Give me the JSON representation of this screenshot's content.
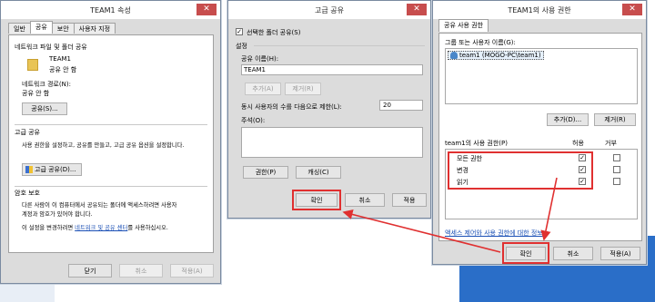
{
  "props": {
    "title": "TEAM1 속성",
    "close_glyph": "✕",
    "tabs": [
      "일반",
      "공유",
      "보안",
      "사용자 지정"
    ],
    "section_network": "네트워크 파일 및 폴더 공유",
    "folder_name": "TEAM1",
    "folder_status": "공유 안 함",
    "network_path_label": "네트워크 경로(N):",
    "network_path_value": "공유 안 함",
    "share_button": "공유(S)...",
    "section_advanced": "고급 공유",
    "advanced_desc": "사용 권한을 설정하고, 공유를 만들고, 고급 공유 옵션을 설정합니다.",
    "advanced_button": "고급 공유(D)...",
    "section_password": "암호 보호",
    "password_desc_1": "다른 사람이 이 컴퓨터에서 공유되는 폴더에 액세스하려면 사용자",
    "password_desc_2": "계정과 암호가 있어야 합니다.",
    "password_change_prefix": "이 설정을 변경하려면 ",
    "password_change_link": "네트워크 및 공유 센터",
    "password_change_suffix": "를 사용하십시오.",
    "close_button": "닫기",
    "cancel_button": "취소",
    "apply_button": "적용(A)"
  },
  "advanced": {
    "title": "고급 공유",
    "share_check_label": "선택한 폴더 공유(S)",
    "share_checked": "✓",
    "settings_label": "설정",
    "share_name_label": "공유 이름(H):",
    "share_name_value": "TEAM1",
    "add_button": "추가(A)",
    "remove_button": "제거(R)",
    "limit_label": "동시 사용자의 수를 다음으로 제한(L):",
    "limit_value": "20",
    "comment_label": "주석(O):",
    "permissions_button": "권한(P)",
    "caching_button": "캐싱(C)",
    "ok_button": "확인",
    "cancel_button": "취소",
    "apply_button": "적용"
  },
  "perm": {
    "title": "TEAM1의 사용 권한",
    "tab": "공유 사용 권한",
    "group_label": "그룹 또는 사용자 이름(G):",
    "user_entry": "team1 (MOGO-PC\\team1)",
    "add_button": "추가(D)...",
    "remove_button": "제거(R)",
    "perm_header": "team1의 사용 권한(P)",
    "allow_header": "허용",
    "deny_header": "거부",
    "rows": [
      {
        "label": "모든 권한",
        "allow": "✓",
        "deny": ""
      },
      {
        "label": "변경",
        "allow": "✓",
        "deny": ""
      },
      {
        "label": "읽기",
        "allow": "✓",
        "deny": ""
      }
    ],
    "access_link": "액세스 제어와 사용 권한에 대한 정보",
    "ok_button": "확인",
    "cancel_button": "취소",
    "apply_button": "적용(A)"
  },
  "colors": {
    "highlight": "#e03030",
    "link": "#1a4fb5",
    "desktop_blue": "#2a6ec8"
  }
}
